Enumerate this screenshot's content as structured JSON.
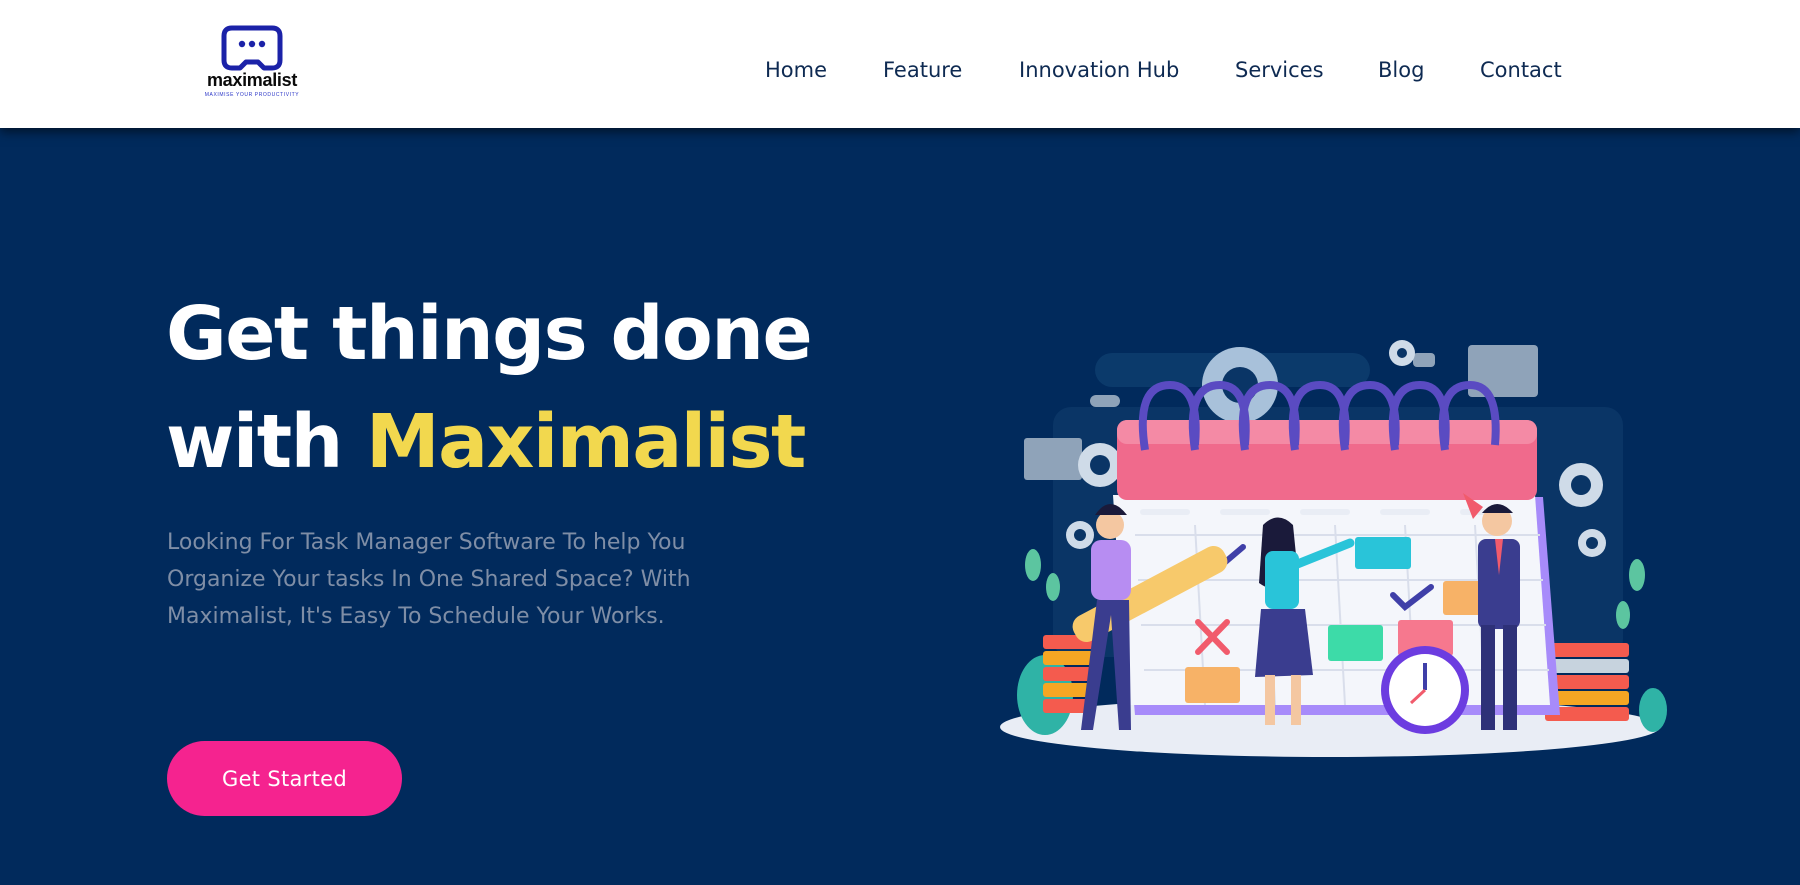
{
  "brand": {
    "name": "maximalist",
    "tagline": "MAXIMISE YOUR PRODUCTIVITY",
    "logo_icon": "gamepad-chat-icon",
    "colors": {
      "primary": "#1b22a8",
      "text": "#0a0a0a"
    }
  },
  "nav": {
    "items": [
      {
        "label": "Home"
      },
      {
        "label": "Feature"
      },
      {
        "label": "Innovation Hub"
      },
      {
        "label": "Services"
      },
      {
        "label": "Blog"
      },
      {
        "label": "Contact"
      }
    ]
  },
  "hero": {
    "headline_line1": "Get things done",
    "headline_line2_prefix": "with ",
    "headline_accent": "Maximalist",
    "description": "Looking For Task Manager Software To help You Organize Your tasks In One Shared Space? With Maximalist, It's Easy To Schedule Your Works.",
    "cta_label": "Get Started",
    "illustration": "team-calendar-planning-illustration"
  },
  "colors": {
    "header_bg": "#ffffff",
    "hero_bg": "#012a5c",
    "accent_yellow": "#f2d84e",
    "cta_pink": "#f5238f",
    "body_text": "#7f8ea6",
    "nav_text": "#0e2a52"
  }
}
